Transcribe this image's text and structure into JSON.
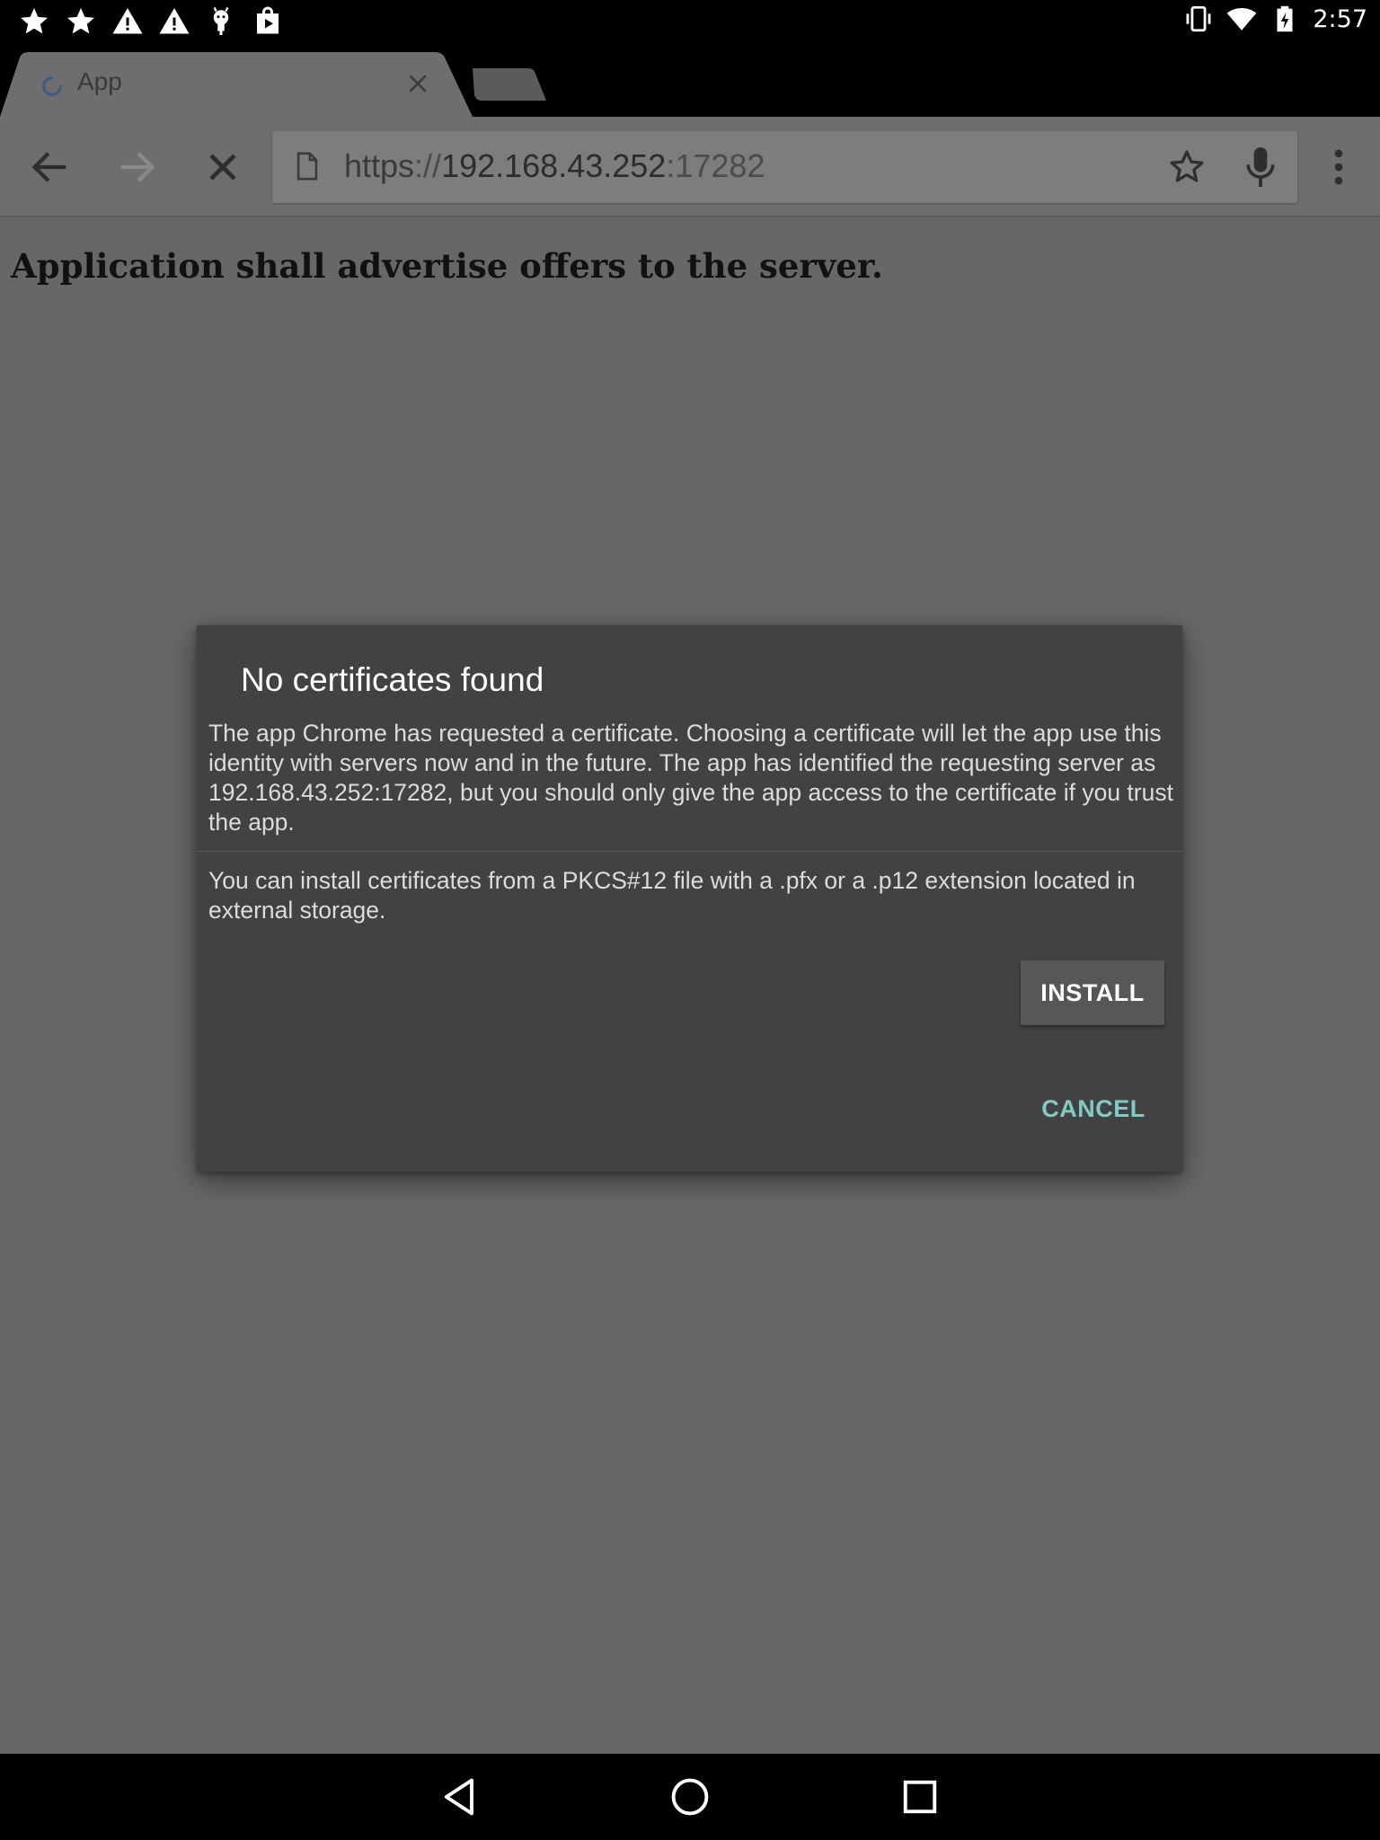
{
  "status_bar": {
    "left_icons": [
      "star-icon",
      "star-icon",
      "warning-icon",
      "warning-icon",
      "android-debug-icon",
      "play-store-icon"
    ],
    "right_icons": [
      "vibrate-icon",
      "wifi-icon",
      "battery-charging-icon"
    ],
    "time": "2:57"
  },
  "tab": {
    "title": "App",
    "loading": true
  },
  "toolbar": {
    "url": {
      "scheme": "https",
      "separator": "://",
      "host": "192.168.43.252",
      "port": ":17282"
    }
  },
  "page": {
    "heading": "Application shall advertise offers to the server."
  },
  "dialog": {
    "title": "No certificates found",
    "message": "The app Chrome has requested a certificate. Choosing a certificate will let the app use this identity with servers now and in the future. The app has identified the requesting server as 192.168.43.252:17282, but you should only give the app access to the certificate if you trust the app.",
    "hint": "You can install certificates from a PKCS#12 file with a .pfx or a .p12 extension located in external storage.",
    "install_label": "INSTALL",
    "cancel_label": "CANCEL"
  },
  "colors": {
    "scrim": "#676767",
    "dialog_bg": "#424242",
    "accent": "#80cbc4"
  }
}
